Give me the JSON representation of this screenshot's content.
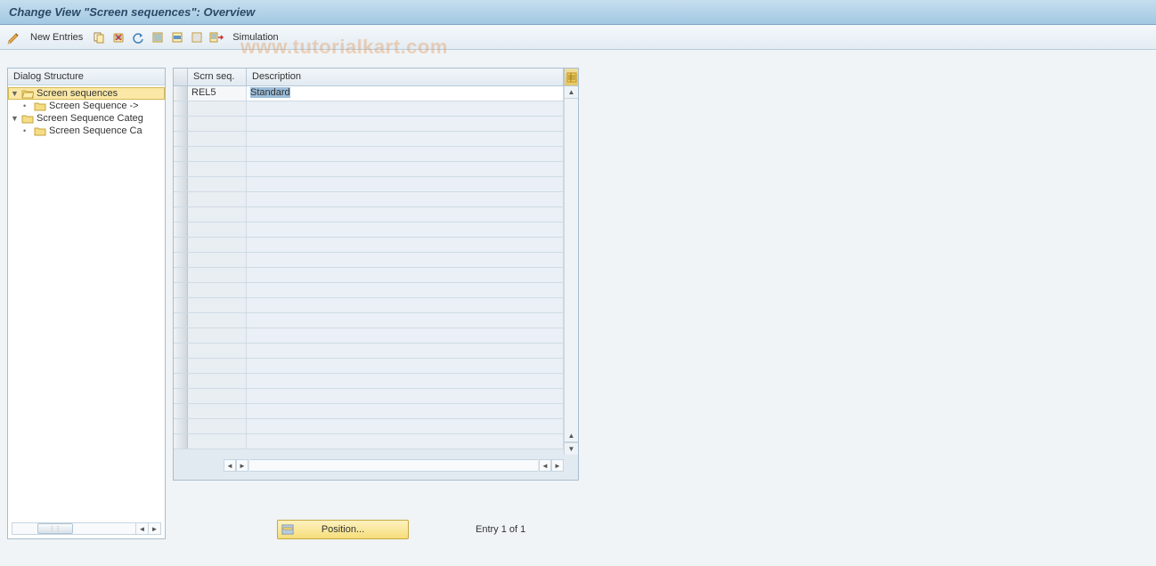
{
  "title": "Change View \"Screen sequences\": Overview",
  "toolbar": {
    "new_entries_label": "New Entries",
    "simulation_label": "Simulation"
  },
  "tree": {
    "header": "Dialog Structure",
    "items": [
      {
        "label": "Screen sequences",
        "level": 0,
        "expanded": true,
        "selected": true,
        "open_folder": true
      },
      {
        "label": "Screen Sequence ->",
        "level": 1,
        "expanded": false,
        "selected": false,
        "open_folder": false,
        "bullet": true
      },
      {
        "label": "Screen Sequence Categ",
        "level": 0,
        "expanded": true,
        "selected": false,
        "open_folder": false
      },
      {
        "label": "Screen Sequence Ca",
        "level": 1,
        "expanded": false,
        "selected": false,
        "open_folder": false,
        "bullet": true
      }
    ]
  },
  "grid": {
    "columns": {
      "seq": "Scrn seq.",
      "desc": "Description"
    },
    "rows": [
      {
        "seq": "REL5",
        "desc": "Standard",
        "desc_selected": true
      }
    ],
    "empty_rows": 22
  },
  "footer": {
    "position_label": "Position...",
    "entry_text": "Entry 1 of 1"
  },
  "watermark": "www.tutorialkart.com"
}
